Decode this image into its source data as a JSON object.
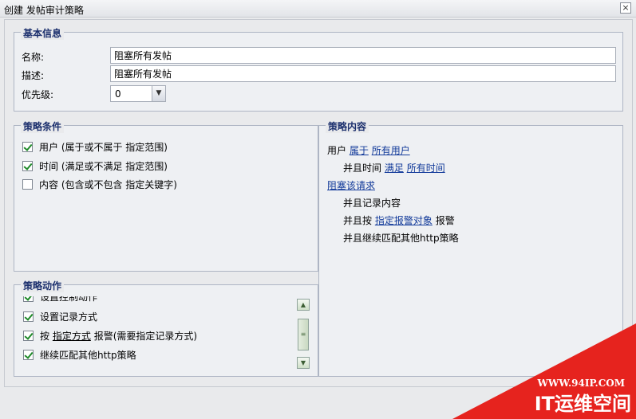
{
  "window": {
    "title": "创建 发帖审计策略",
    "close": "×"
  },
  "basic": {
    "legend": "基本信息",
    "name_label": "名称:",
    "name_value": "阻塞所有发帖",
    "desc_label": "描述:",
    "desc_value": "阻塞所有发帖",
    "priority_label": "优先级:",
    "priority_value": "0"
  },
  "conditions": {
    "legend": "策略条件",
    "items": [
      {
        "label": "用户 (属于或不属于 指定范围)",
        "checked": true
      },
      {
        "label": "时间 (满足或不满足 指定范围)",
        "checked": true
      },
      {
        "label": "内容 (包含或不包含 指定关键字)",
        "checked": false
      }
    ]
  },
  "actions": {
    "legend": "策略动作",
    "items": [
      {
        "label": "设置控制动作",
        "checked": true
      },
      {
        "label": "设置记录方式",
        "checked": true
      },
      {
        "prefix": "按",
        "link": "指定方式",
        "suffix": "报警(需要指定记录方式)",
        "checked": true
      },
      {
        "label": "继续匹配其他http策略",
        "checked": true
      }
    ]
  },
  "content": {
    "legend": "策略内容",
    "line1": {
      "a": "用户",
      "link1": "属于",
      "link2": "所有用户"
    },
    "line2": {
      "a": "并且时间",
      "link1": "满足",
      "link2": "所有时间"
    },
    "line3": {
      "link": "阻塞该请求"
    },
    "line4": {
      "a": "并且记录内容"
    },
    "line5": {
      "a": "并且按",
      "link": "指定报警对象",
      "b": "报警"
    },
    "line6": {
      "a": "并且继续匹配其他http策略"
    }
  },
  "watermark": {
    "url": "WWW.94IP.COM",
    "brand": "IT运维空间",
    "color": "#e6231e"
  }
}
